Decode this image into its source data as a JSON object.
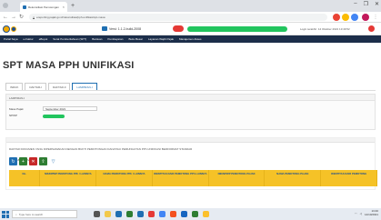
{
  "browser": {
    "tab_title": "Rekonsiliasi Pemotongan",
    "new_tab_symbol": "+",
    "url": "ereporting.pajak.go.id/rekonsiliasi/pph-unifikasi/spt-masa",
    "window_controls": [
      "–",
      "❐",
      "✕"
    ]
  },
  "header": {
    "version": "Versi: 1.1.2-build-2008",
    "session_meta": "v1.0",
    "login_time": "Login terakhir: 14 Oktober 2021 13:40:52"
  },
  "nav": {
    "items": [
      "Portal Saya",
      "e-Faktur",
      "eBupot",
      "Surat Pemberitahuan (SPT)",
      "Bantuan",
      "Pembayaran",
      "Buku Besar",
      "Layanan Wajib Pajak",
      "Manajemen Akses"
    ]
  },
  "page": {
    "title": "SPT MASA PPH UNIFIKASI",
    "tabs": [
      "INDUK",
      "DAFTAR-I",
      "DAFTAR-II",
      "LAMPIRAN-I"
    ],
    "active_tab": 3
  },
  "form": {
    "panel_title": "LAMPIRAN-I",
    "masa_pajak_label": "Masa Pajak",
    "masa_pajak_value": "September 2021",
    "npwp_label": "NPWP"
  },
  "section": {
    "heading": "DAFTAR DOKUMEN YANG DIPERSAMAKAN DENGAN BUKTI PEMOTONGAN DAN/ATAU PEMUNGUTAN PPh UNIFIKASI BERFORMAT STANDAR",
    "subheading": "▾  TABEL 1 (IV)"
  },
  "table": {
    "columns": [
      "No.",
      "NIK/NPWP PEMOTONG PPh / LAINNYA",
      "NAMA PEMOTONG PPh / LAINNYA",
      "IDENTITAS DARI PEMOTONG PPh LAINNYA",
      "NIK/NPWP PEMOTONG PAJAK",
      "NAMA PEMOTONG PAJAK",
      "IDENTITAS DARI PEMOTONG"
    ]
  },
  "taskbar": {
    "search_placeholder": "Type here to search",
    "time": "13:40",
    "date": "14/10/2021"
  },
  "colors": {
    "nav_bg": "#1c2e4a",
    "table_header": "#f5c227",
    "accent": "#1f6fb2",
    "redaction": "#22c55e"
  }
}
